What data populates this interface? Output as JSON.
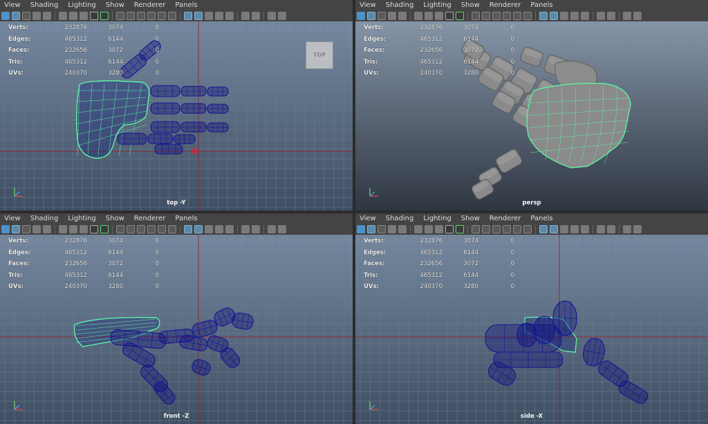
{
  "menu": [
    "View",
    "Shading",
    "Lighting",
    "Show",
    "Renderer",
    "Panels"
  ],
  "stats": {
    "labels": [
      "Verts:",
      "Edges:",
      "Faces:",
      "Tris:",
      "UVs:"
    ],
    "col1": [
      "232876",
      "465312",
      "232656",
      "465312",
      "240370"
    ],
    "col2": [
      "3074",
      "6144",
      "3072",
      "6144",
      "3280"
    ],
    "col3": [
      "0",
      "0",
      "0",
      "0",
      "0"
    ]
  },
  "panels": {
    "top": {
      "camera": "top -Y",
      "viewcube": "TOP"
    },
    "persp": {
      "camera": "persp"
    },
    "front": {
      "camera": "front -Z"
    },
    "side": {
      "camera": "side -X"
    }
  },
  "colors": {
    "wire": "#141496",
    "selected": "#5df2a4",
    "grid_line": "#6a7c8f",
    "axis_line": "#8b2a3a",
    "persp_mesh": "#8a8a8a"
  },
  "icons": [
    "select-camera-icon",
    "camera-attributes-icon",
    "bookmark-icon",
    "image-plane-icon",
    "grid-icon",
    "film-gate-icon",
    "resolution-gate-icon",
    "wireframe-icon",
    "smooth-shade-icon",
    "textured-icon",
    "lights-icon",
    "shadows-icon",
    "isolate-icon",
    "xray-icon"
  ]
}
